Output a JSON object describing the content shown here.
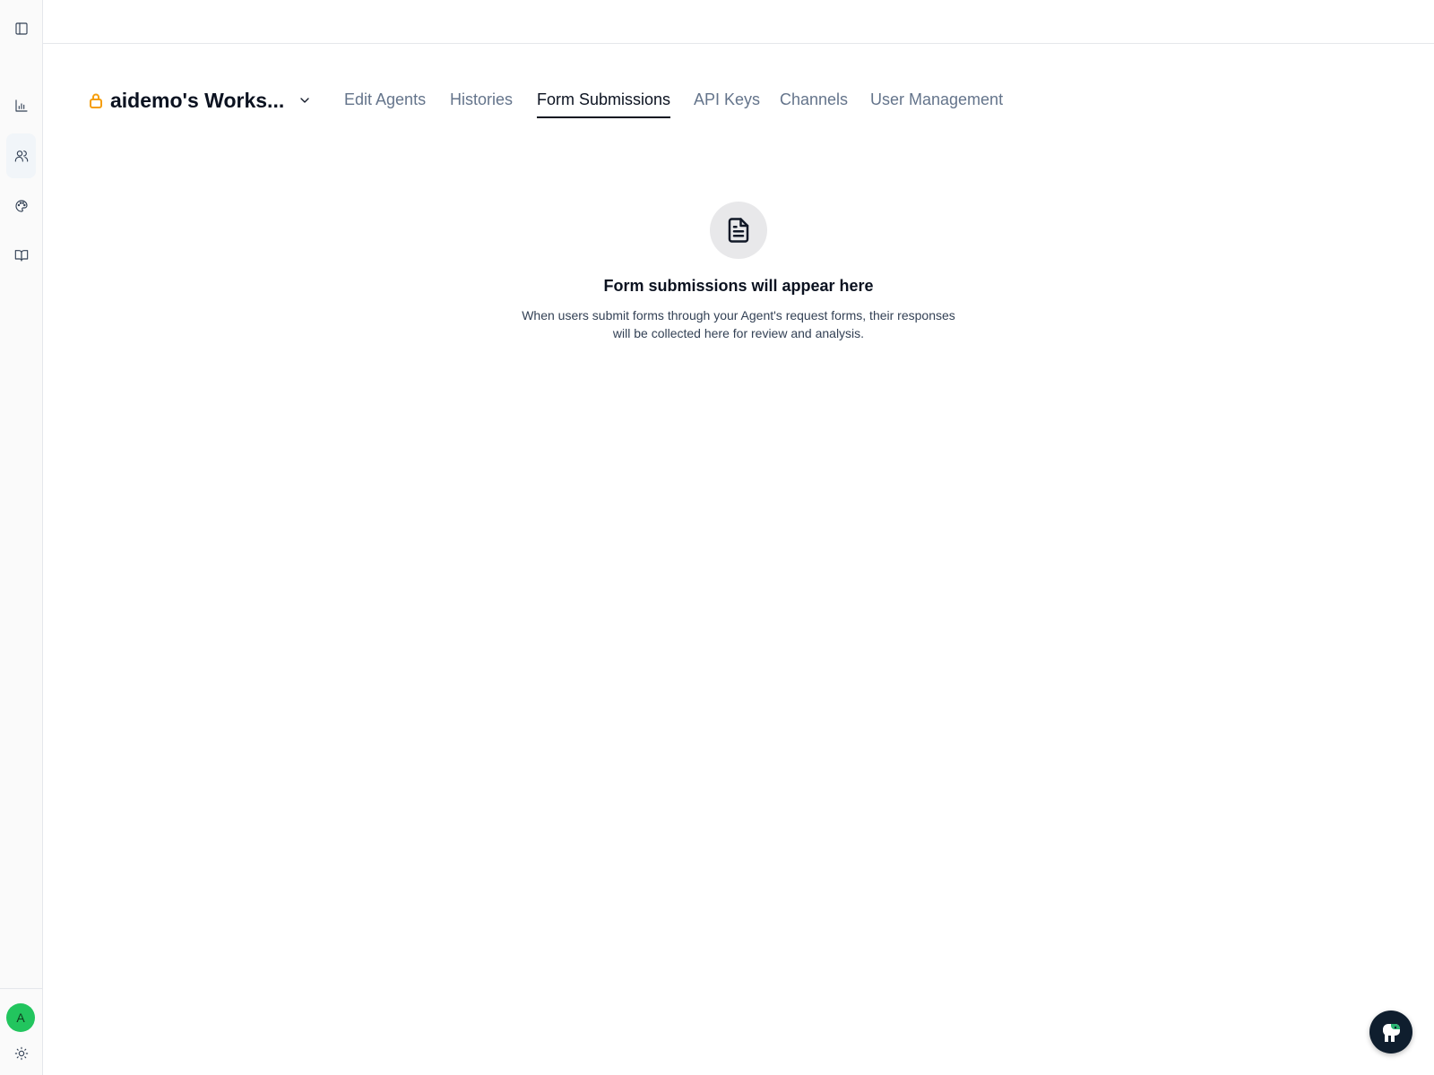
{
  "workspace": {
    "name": "aidemo's Works...",
    "lock_icon": "lock-icon",
    "lock_color": "#f59e0b",
    "dropdown_icon": "chevron-down-icon"
  },
  "tabs": [
    {
      "label": "Edit Agents",
      "active": false
    },
    {
      "label": "Histories",
      "active": false
    },
    {
      "label": "Form Submissions",
      "active": true
    },
    {
      "label": "API Keys",
      "active": false
    },
    {
      "label": "Channels",
      "active": false
    },
    {
      "label": "User Management",
      "active": false
    }
  ],
  "sidebar": {
    "items": [
      {
        "icon": "panel-toggle-icon"
      },
      {
        "icon": "bar-chart-icon"
      },
      {
        "icon": "users-icon",
        "active": true
      },
      {
        "icon": "palette-icon"
      },
      {
        "icon": "book-icon"
      }
    ],
    "avatar": {
      "initial": "A",
      "color": "#22c55e"
    },
    "theme_icon": "sun-icon"
  },
  "empty_state": {
    "icon": "document-icon",
    "title": "Form submissions will appear here",
    "description": "When users submit forms through your Agent's request forms, their responses will be collected here for review and analysis."
  },
  "help_button": {
    "icon": "assistant-logo-icon",
    "color": "#0f1e2e"
  }
}
